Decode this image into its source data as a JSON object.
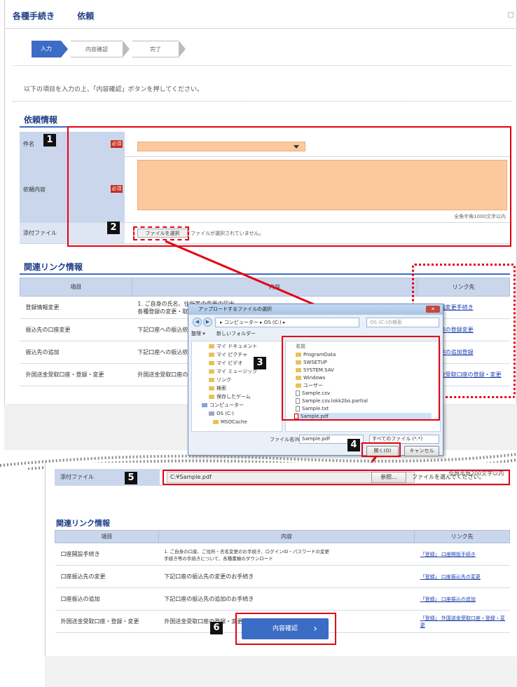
{
  "header": {
    "title": "各種手続き",
    "subtitle": "依頼",
    "right_mark": "□"
  },
  "steps": [
    "入力",
    "内容確認",
    "完了"
  ],
  "instruction": "以下の項目を入力の上、「内容確認」ボタンを押してください。",
  "section1": {
    "title": "依頼情報",
    "rows": [
      {
        "label": "件名",
        "required": "必須"
      },
      {
        "label": "依頼内容",
        "required": "必須",
        "counter": "全角半角1000文字以内"
      },
      {
        "label": "添付ファイル",
        "button": "ファイルを選択",
        "note": "ファイルが選択されていません。"
      }
    ]
  },
  "section2": {
    "title": "関連リンク情報",
    "headers": [
      "項目",
      "内容",
      "リンク先"
    ],
    "rows": [
      {
        "item": "登録情報変更",
        "content": "1. ご自身の氏名、住所等の変更の届出",
        "content2": "各種登録の変更・取り消しのお手続き",
        "link": "登録情報変更手続き"
      },
      {
        "item": "振込先の口座変更",
        "content": "下記口座への振込依頼等",
        "link": "各種口座の登録変更"
      },
      {
        "item": "振込先の追加",
        "content": "下記口座への振込依頼等",
        "link": "各種口座の追加登録"
      },
      {
        "item": "外国送金受取口座・登録・変更",
        "content": "外国送金受取口座の登録・変更",
        "link": "外国送金受取口座の登録・変更"
      }
    ]
  },
  "dialog": {
    "title": "アップロードするファイルの選択",
    "close": "✕",
    "path": "▸ コンピューター ▸ OS (C:) ▸",
    "search": "OS (C:)の検索",
    "toolbar": [
      "整理 ▾",
      "新しいフォルダー"
    ],
    "nav_items": [
      "マイ ドキュメント",
      "マイ ピクチャ",
      "マイ ビデオ",
      "マイ ミュージック",
      "リンク",
      "検索",
      "保存したゲーム",
      "コンピューター",
      "OS (C:)",
      "MSOCache"
    ],
    "file_header": "名前",
    "files": [
      "ProgramData",
      "SWSETUP",
      "SYSTEM.SAV",
      "Windows",
      "ユーザー",
      "Sample.csv",
      "Sample.csv.lokk2bo.partial",
      "Sample.txt",
      "Sample.pdf"
    ],
    "filename_label": "ファイル名(N):",
    "filename_value": "Sample.pdf",
    "filetype": "すべてのファイル (*.*)",
    "open": "開く(O)",
    "cancel": "キャンセル"
  },
  "numbers": [
    "1",
    "2",
    "3",
    "4",
    "5",
    "6"
  ],
  "bottom": {
    "counter_note": "全角半角200文字以内",
    "attach_label": "添付ファイル",
    "attach_path": "C:¥Sample.pdf",
    "browse": "参照...",
    "attach_note": "ファイルを選んでください。",
    "section_title": "関連リンク情報",
    "headers": [
      "項目",
      "内容",
      "リンク先"
    ],
    "rows": [
      {
        "item": "口座開設手続き",
        "content": "1. ご自身の口座、ご住所・氏名変更のお手続き、ログインID・パスワードの変更",
        "content2": "手続き等の手続きについて、各種書類のダウンロード",
        "link": "「登録」 口座開設手続き"
      },
      {
        "item": "口座振込先の変更",
        "content": "下記口座の振込先の変更のお手続き",
        "link": "「登録」 口座振込先の変更"
      },
      {
        "item": "口座振込の追加",
        "content": "下記口座の振込先の追加のお手続き",
        "link": "「登録」 口座振込の追加"
      },
      {
        "item": "外国送金受取口座・登録・変更",
        "content": "外国送金受取口座の登録・変更のお手続き",
        "link": "「登録」 外国送金受取口座・登録・変更"
      }
    ],
    "confirm": "内容確認"
  }
}
